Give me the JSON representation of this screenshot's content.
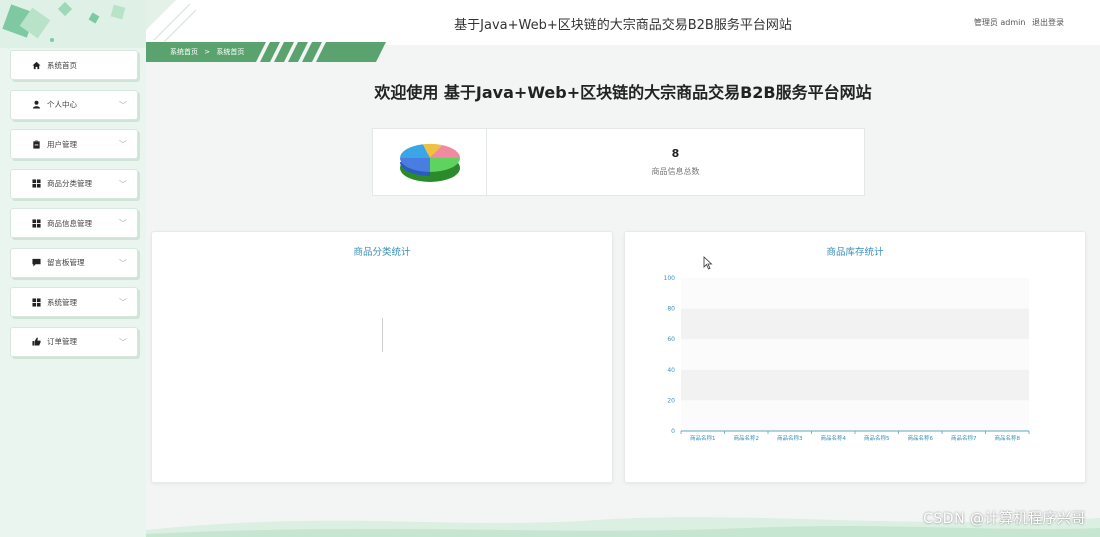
{
  "header": {
    "title": "基于Java+Web+区块链的大宗商品交易B2B服务平台网站",
    "user_label": "管理员 admin",
    "logout": "退出登录"
  },
  "breadcrumb": {
    "home": "系统首页",
    "separator": ">",
    "current": "系统首页"
  },
  "sidebar": {
    "items": [
      {
        "label": "系统首页",
        "icon": "home-icon",
        "has_arrow": false
      },
      {
        "label": "个人中心",
        "icon": "person-icon",
        "has_arrow": true
      },
      {
        "label": "用户管理",
        "icon": "clipboard-icon",
        "has_arrow": true
      },
      {
        "label": "商品分类管理",
        "icon": "grid-icon",
        "has_arrow": true
      },
      {
        "label": "商品信息管理",
        "icon": "grid-icon",
        "has_arrow": true
      },
      {
        "label": "留言板管理",
        "icon": "message-icon",
        "has_arrow": true
      },
      {
        "label": "系统管理",
        "icon": "grid-icon",
        "has_arrow": true
      },
      {
        "label": "订单管理",
        "icon": "thumbs-up-icon",
        "has_arrow": true
      }
    ]
  },
  "main": {
    "welcome": "欢迎使用 基于Java+Web+区块链的大宗商品交易B2B服务平台网站",
    "stat": {
      "value": "8",
      "label": "商品信息总数",
      "icon": "pie-chart-icon"
    },
    "panel_left_title": "商品分类统计",
    "panel_right_title": "商品库存统计"
  },
  "watermark": "CSDN @计算机程序兴哥",
  "colors": {
    "accent": "#3a8fb7",
    "brand_green": "#5aa36e",
    "sidebar_bg": "#e9f5ee"
  },
  "chart_data": {
    "type": "bar",
    "title": "商品库存统计",
    "categories": [
      "商品名称1",
      "商品名称2",
      "商品名称3",
      "商品名称4",
      "商品名称5",
      "商品名称6",
      "商品名称7",
      "商品名称8"
    ],
    "values": [
      0,
      0,
      0,
      0,
      0,
      0,
      0,
      0
    ],
    "ylim": [
      0,
      100
    ],
    "yticks": [
      0,
      20,
      40,
      60,
      80,
      100
    ],
    "xlabel": "",
    "ylabel": "",
    "grid": true
  }
}
